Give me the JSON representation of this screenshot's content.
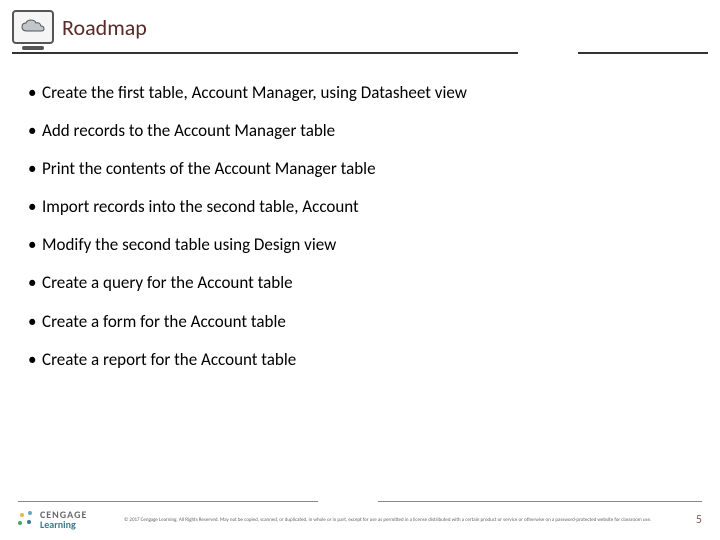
{
  "header": {
    "title": "Roadmap",
    "icon": "cloud-monitor-icon"
  },
  "bullets": [
    "Create the first table, Account Manager, using Datasheet view",
    "Add records to the Account Manager table",
    "Print the contents of the Account Manager table",
    "Import records into the second table, Account",
    "Modify the second table using Design view",
    "Create a query for the Account table",
    "Create a form for the Account table",
    "Create a report for the Account table"
  ],
  "footer": {
    "logo_line1": "CENGAGE",
    "logo_line2": "Learning",
    "copyright": "© 2017 Cengage Learning. All Rights Reserved. May not be copied, scanned, or duplicated, in whole or in part, except for use as permitted in a license distributed with a certain product or service or otherwise on a password-protected website for classroom use.",
    "page_number": "5"
  }
}
